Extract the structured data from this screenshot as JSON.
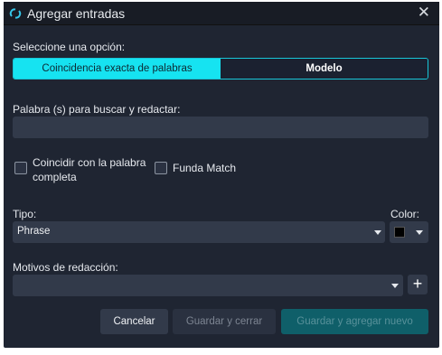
{
  "window": {
    "title": "Agregar entradas"
  },
  "option": {
    "label": "Seleccione una opción:",
    "segments": [
      "Coincidencia exacta de palabras",
      "Modelo"
    ]
  },
  "search": {
    "label": "Palabra (s) para buscar y redactar:",
    "value": ""
  },
  "checkboxes": {
    "whole_word_line1": "Coincidir con la palabra",
    "whole_word_line2": "completa",
    "case": "Funda Match"
  },
  "type": {
    "label": "Tipo:",
    "value": "Phrase"
  },
  "color": {
    "label": "Color:",
    "value": "#000000"
  },
  "reasons": {
    "label": "Motivos de redacción:",
    "value": ""
  },
  "buttons": {
    "cancel": "Cancelar",
    "save_close": "Guardar y cerrar",
    "save_add": "Guardar y agregar nuevo",
    "add": "+"
  },
  "colors": {
    "accent": "#16e3f1",
    "background": "#1f2532",
    "field": "#323a4a"
  }
}
